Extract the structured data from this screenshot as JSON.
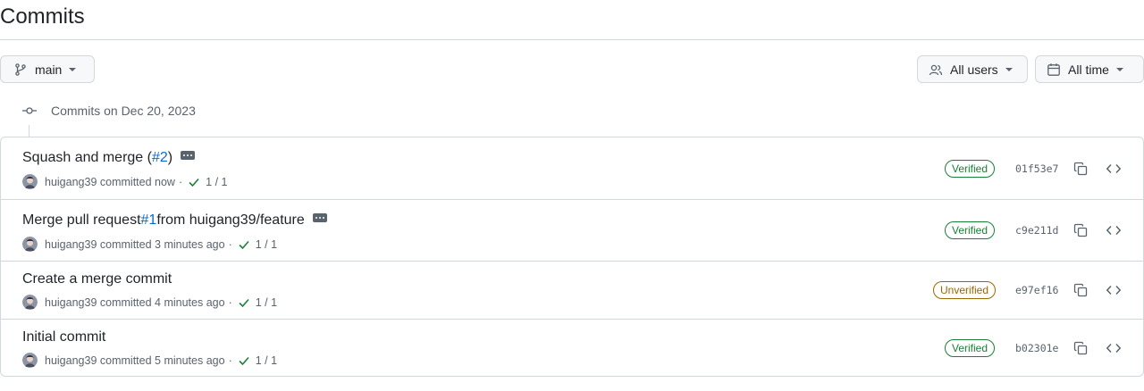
{
  "page": {
    "title": "Commits"
  },
  "toolbar": {
    "branch": {
      "label": "main",
      "icon": "git-branch-icon"
    },
    "users": {
      "label": "All users",
      "icon": "people-icon"
    },
    "time": {
      "label": "All time",
      "icon": "calendar-icon"
    }
  },
  "timeline": {
    "heading": "Commits on Dec 20, 2023",
    "icon": "git-commit-icon"
  },
  "colors": {
    "link": "#0969da",
    "verified": "#1a7f37",
    "unverified": "#9a6700",
    "muted": "#59636e",
    "border": "#d1d9e0"
  },
  "commits": [
    {
      "message_pre": "Squash and merge (",
      "message_link": "#2",
      "message_post": ")",
      "has_ellipsis": true,
      "author": "huigang39",
      "action": "committed",
      "time": "now",
      "checks": "1 / 1",
      "badge": "Verified",
      "sha": "01f53e7"
    },
    {
      "message_pre": "Merge pull request ",
      "message_link": "#1",
      "message_post": " from huigang39/feature",
      "has_ellipsis": true,
      "author": "huigang39",
      "action": "committed",
      "time": "3 minutes ago",
      "checks": "1 / 1",
      "badge": "Verified",
      "sha": "c9e211d"
    },
    {
      "message_pre": "Create a merge commit",
      "message_link": "",
      "message_post": "",
      "has_ellipsis": false,
      "author": "huigang39",
      "action": "committed",
      "time": "4 minutes ago",
      "checks": "1 / 1",
      "badge": "Unverified",
      "sha": "e97ef16"
    },
    {
      "message_pre": "Initial commit",
      "message_link": "",
      "message_post": "",
      "has_ellipsis": false,
      "author": "huigang39",
      "action": "committed",
      "time": "5 minutes ago",
      "checks": "1 / 1",
      "badge": "Verified",
      "sha": "b02301e"
    }
  ]
}
